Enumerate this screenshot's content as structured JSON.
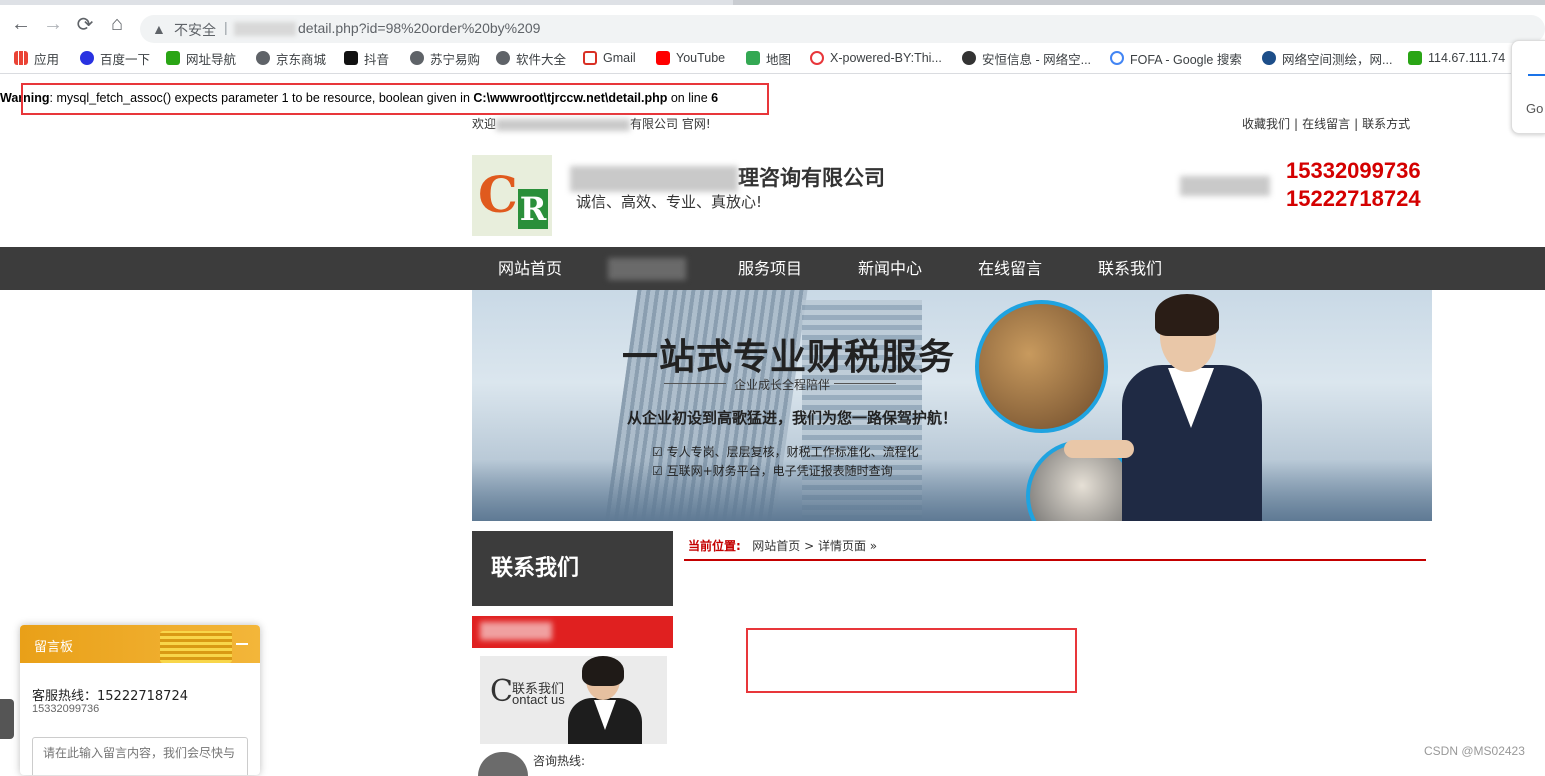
{
  "browser": {
    "security_label": "不安全",
    "url_path": "detail.php?id=98%20order%20by%209",
    "bookmarks": [
      {
        "label": "应用",
        "color": "#4285f4"
      },
      {
        "label": "百度一下",
        "color": "#2932e1"
      },
      {
        "label": "网址导航",
        "color": "#2aa515"
      },
      {
        "label": "京东商城",
        "color": "#5f6368"
      },
      {
        "label": "抖音",
        "color": "#111111"
      },
      {
        "label": "苏宁易购",
        "color": "#5f6368"
      },
      {
        "label": "软件大全",
        "color": "#5f6368"
      },
      {
        "label": "Gmail",
        "color": "#d93025"
      },
      {
        "label": "YouTube",
        "color": "#ff0000"
      },
      {
        "label": "地图",
        "color": "#34a853"
      },
      {
        "label": "X-powered-BY:Thi...",
        "color": "#e8363a"
      },
      {
        "label": "安恒信息 - 网络空...",
        "color": "#333333"
      },
      {
        "label": "FOFA - Google 搜索",
        "color": "#4285f4"
      },
      {
        "label": "网络空间测绘，网...",
        "color": "#1d4e89"
      },
      {
        "label": "114.67.111.74",
        "color": "#2aa515"
      }
    ],
    "popup_text": "Go"
  },
  "warning": {
    "prefix": "Warning",
    "message": ": mysql_fetch_assoc() expects parameter 1 to be resource, boolean given in ",
    "file": "C:\\wwwroot\\tjrccw.net\\detail.php",
    "on_line": " on line ",
    "line": "6"
  },
  "site": {
    "welcome_start": "欢迎",
    "welcome_end": "有限公司 官网!",
    "top_links": [
      "收藏我们",
      "在线留言",
      "联系方式"
    ],
    "company_suffix": "理咨询有限公司",
    "slogan": "诚信、高效、专业、真放心!",
    "phones": [
      "15332099736",
      "15222718724"
    ],
    "nav": [
      "网站首页",
      "服务项目",
      "新闻中心",
      "在线留言",
      "联系我们"
    ],
    "banner": {
      "headline": "一站式专业财税服务",
      "sub": "企业成长全程陪伴",
      "line2": "从企业初设到高歌猛进，我们为您一路保驾护航！",
      "check1": "专人专岗、层层复核，财税工作标准化、流程化",
      "check2": "互联网+财务平台，电子凭证报表随时查询"
    },
    "sidebar": {
      "title": "联系我们",
      "contact_cn": "联系我们",
      "contact_en": "ontact us",
      "hotline_label": "咨询热线:"
    },
    "breadcrumb": {
      "label": "当前位置:",
      "path": "网站首页 > 详情页面 »"
    }
  },
  "message_board": {
    "title": "留言板",
    "hotline": "客服热线：15222718724",
    "hotline2": "15332099736",
    "placeholder": "请在此输入留言内容，我们会尽快与"
  },
  "watermark": "CSDN @MS02423",
  "colors": {
    "nav_bg": "#3c3c3c",
    "accent_red": "#d40000",
    "highlight_box": "#e8363a"
  }
}
